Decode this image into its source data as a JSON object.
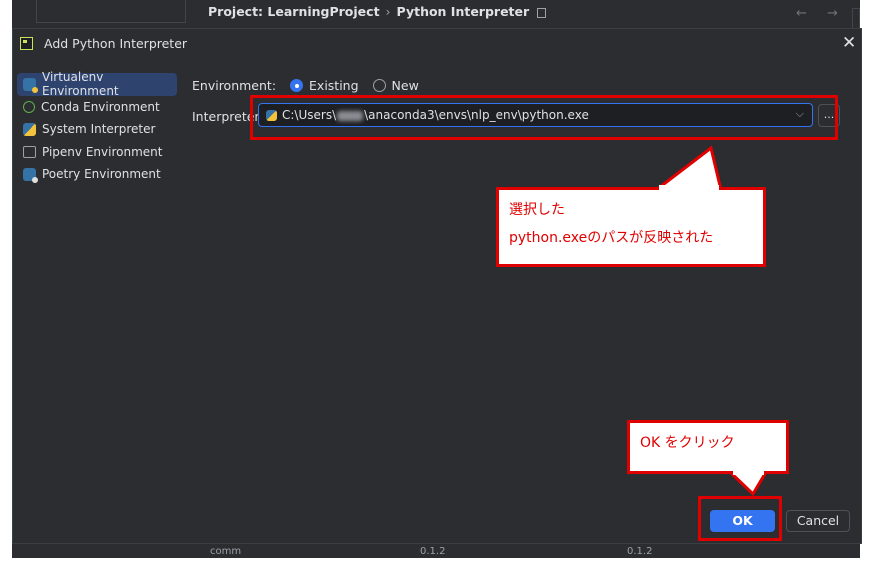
{
  "background": {
    "breadcrumb_project": "Project: LearningProject",
    "breadcrumb_sep": "›",
    "breadcrumb_page": "Python Interpreter",
    "nav_arrows": "← →",
    "bottom_col1": "comm",
    "bottom_col2": "0.1.2",
    "bottom_col3": "0.1.2"
  },
  "dialog": {
    "title": "Add Python Interpreter",
    "close_glyph": "✕",
    "sidebar": {
      "items": [
        {
          "label": "Virtualenv Environment",
          "icon": "virtualenv-icon",
          "selected": true
        },
        {
          "label": "Conda Environment",
          "icon": "conda-icon",
          "selected": false
        },
        {
          "label": "System Interpreter",
          "icon": "python-icon",
          "selected": false
        },
        {
          "label": "Pipenv Environment",
          "icon": "folder-icon",
          "selected": false
        },
        {
          "label": "Poetry Environment",
          "icon": "poetry-icon",
          "selected": false
        }
      ]
    },
    "environment": {
      "label": "Environment:",
      "options": [
        {
          "label": "Existing",
          "selected": true
        },
        {
          "label": "New",
          "selected": false
        }
      ]
    },
    "interpreter": {
      "label": "Interpreter",
      "path_prefix": "C:\\Users\\",
      "path_suffix": "\\anaconda3\\envs\\nlp_env\\python.exe",
      "chevron": "⌵",
      "browse_label": "..."
    },
    "buttons": {
      "ok": "OK",
      "cancel": "Cancel"
    }
  },
  "annotations": {
    "callout1_line1": "選択した",
    "callout1_line2": "python.exeのパスが反映された",
    "callout2": "OK をクリック",
    "color": "#e00000"
  },
  "colors": {
    "dialog_bg": "#2b2d30",
    "accent": "#3574f0",
    "text": "#dfe1e5"
  }
}
